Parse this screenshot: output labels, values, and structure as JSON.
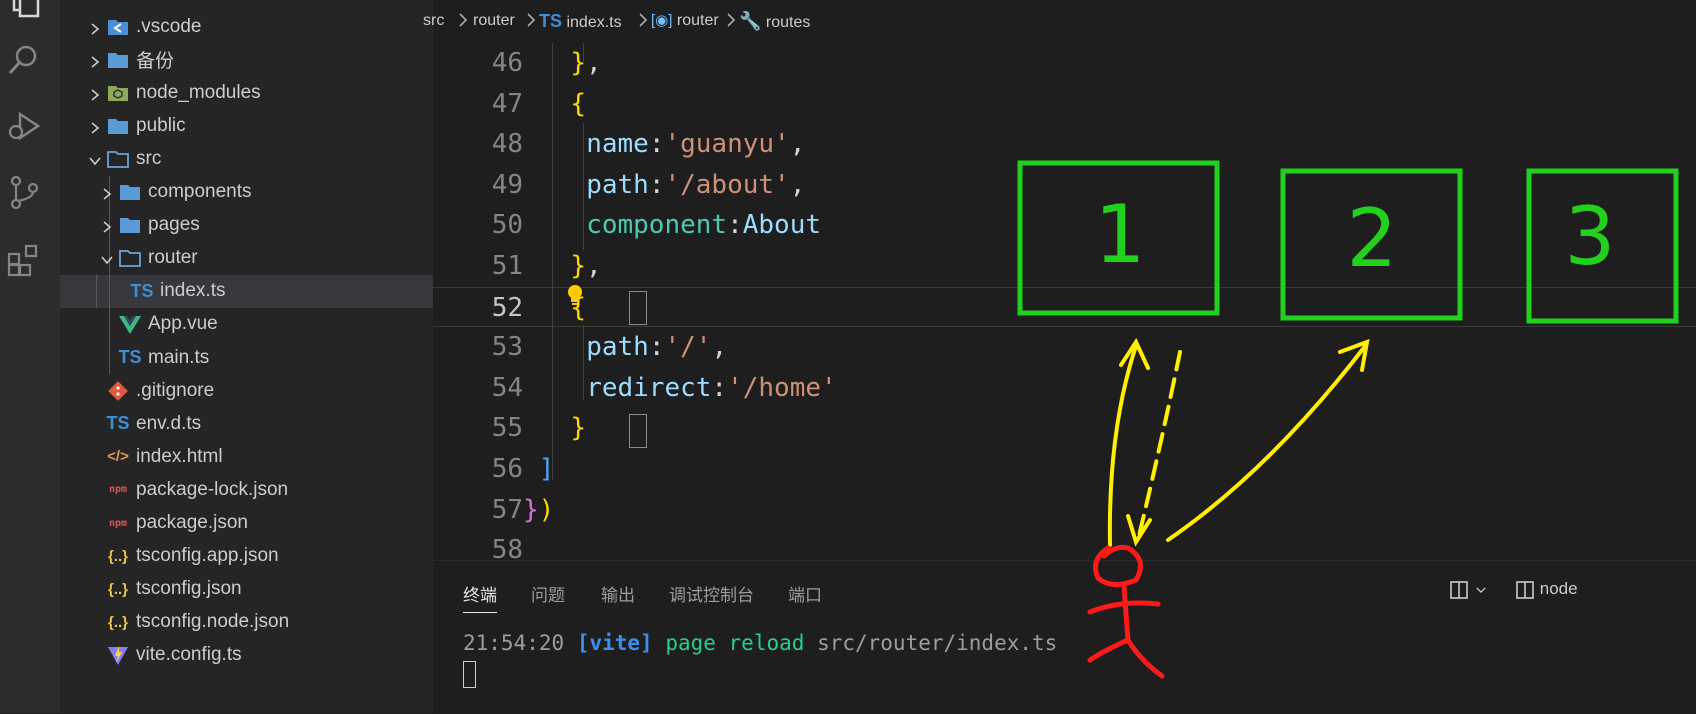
{
  "explorer": {
    "items": [
      {
        "label": ".vscode",
        "kind": "folder-vscode",
        "expanded": false
      },
      {
        "label": "备份",
        "kind": "folder",
        "expanded": false
      },
      {
        "label": "node_modules",
        "kind": "folder-node",
        "expanded": false
      },
      {
        "label": "public",
        "kind": "folder",
        "expanded": false
      },
      {
        "label": "src",
        "kind": "folder-open",
        "expanded": true
      },
      {
        "label": "components",
        "kind": "folder",
        "expanded": false
      },
      {
        "label": "pages",
        "kind": "folder",
        "expanded": false
      },
      {
        "label": "router",
        "kind": "folder-open",
        "expanded": true
      },
      {
        "label": "index.ts",
        "kind": "ts",
        "selected": true
      },
      {
        "label": "App.vue",
        "kind": "vue"
      },
      {
        "label": "main.ts",
        "kind": "ts"
      },
      {
        "label": ".gitignore",
        "kind": "git"
      },
      {
        "label": "env.d.ts",
        "kind": "ts"
      },
      {
        "label": "index.html",
        "kind": "html"
      },
      {
        "label": "package-lock.json",
        "kind": "npm"
      },
      {
        "label": "package.json",
        "kind": "npm"
      },
      {
        "label": "tsconfig.app.json",
        "kind": "json"
      },
      {
        "label": "tsconfig.json",
        "kind": "json"
      },
      {
        "label": "tsconfig.node.json",
        "kind": "json"
      },
      {
        "label": "vite.config.ts",
        "kind": "vite"
      }
    ],
    "badge_ts": "TS"
  },
  "breadcrumb": {
    "parts": [
      "src",
      "router",
      "index.ts",
      "router",
      "routes"
    ],
    "ts_badge": "TS"
  },
  "editor": {
    "current_line": "52",
    "lines": [
      {
        "n": "46",
        "code": "},"
      },
      {
        "n": "47",
        "code": "{"
      },
      {
        "n": "48",
        "prop": "name",
        "value": "'guanyu'",
        "trail": ","
      },
      {
        "n": "49",
        "prop": "path",
        "value": "'/about'",
        "trail": ","
      },
      {
        "n": "50",
        "prop": "component",
        "value": "About",
        "trail": ""
      },
      {
        "n": "51",
        "code": "},"
      },
      {
        "n": "52",
        "code": "{"
      },
      {
        "n": "53",
        "prop": "path",
        "value": "'/'",
        "trail": ","
      },
      {
        "n": "54",
        "prop": "redirect",
        "value": "'/home'",
        "trail": ""
      },
      {
        "n": "55",
        "code": "}"
      },
      {
        "n": "56",
        "code": "]"
      },
      {
        "n": "57",
        "code": "})"
      },
      {
        "n": "58",
        "code": ""
      }
    ],
    "tokens": {
      "colon": ":",
      "comma": ",",
      "brace_close": "}",
      "brace_open": "{",
      "bracket_close": "]",
      "paren_close": ")"
    }
  },
  "panel": {
    "tabs": [
      "终端",
      "问题",
      "输出",
      "调试控制台",
      "端口"
    ],
    "active_tab": "终端",
    "right_label": "node",
    "terminal": {
      "time": "21:54:20",
      "tag": "[vite]",
      "message": "page reload",
      "path": "src/router/index.ts"
    }
  },
  "annotation": {
    "boxes": [
      "1",
      "2",
      "3"
    ],
    "colors": {
      "box": "#22d11d",
      "arrow": "#ffee00",
      "figure": "#ff1a1a"
    }
  }
}
